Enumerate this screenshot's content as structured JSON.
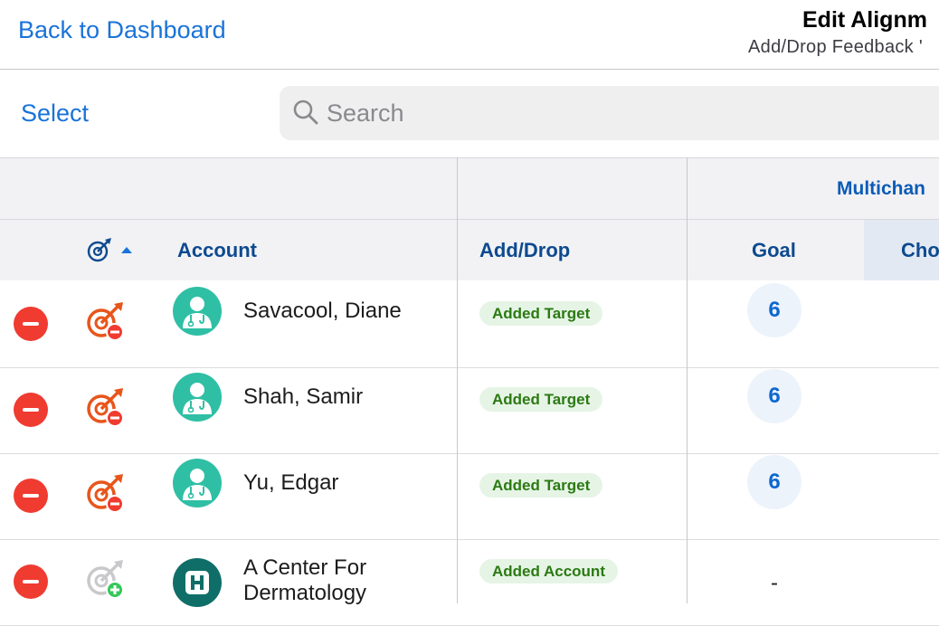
{
  "nav": {
    "back_label": "Back to Dashboard",
    "title": "Edit Alignm",
    "subtitle": "Add/Drop Feedback '"
  },
  "toolbar": {
    "select_label": "Select",
    "search_placeholder": "Search"
  },
  "table": {
    "group_header": "Multichan",
    "columns": {
      "target_sort": "target-icon, sorted ascending",
      "account": "Account",
      "add_drop": "Add/Drop",
      "goal": "Goal",
      "cho": "Cho"
    },
    "rows": [
      {
        "name": "Savacool, Diane",
        "status": "Added Target",
        "goal": "6",
        "target_state": "remove",
        "avatar": "doctor-avatar"
      },
      {
        "name": "Shah, Samir",
        "status": "Added Target",
        "goal": "6",
        "target_state": "remove",
        "avatar": "doctor-avatar"
      },
      {
        "name": "Yu, Edgar",
        "status": "Added Target",
        "goal": "6",
        "target_state": "remove",
        "avatar": "doctor-avatar"
      },
      {
        "name": "A Center For Dermatology",
        "name_line1": "A Center For",
        "name_line2": "Dermatology",
        "status": "Added Account",
        "goal": "-",
        "target_state": "add",
        "avatar": "hospital-avatar"
      }
    ]
  },
  "colors": {
    "accent": "#1a73d9",
    "header_text": "#0d4a8f",
    "remove_red": "#f03b30",
    "target_orange": "#e8551b",
    "badge_green": "#2b7a12",
    "avatar_teal": "#2fbfa5",
    "hospital_teal": "#0f6e68"
  }
}
